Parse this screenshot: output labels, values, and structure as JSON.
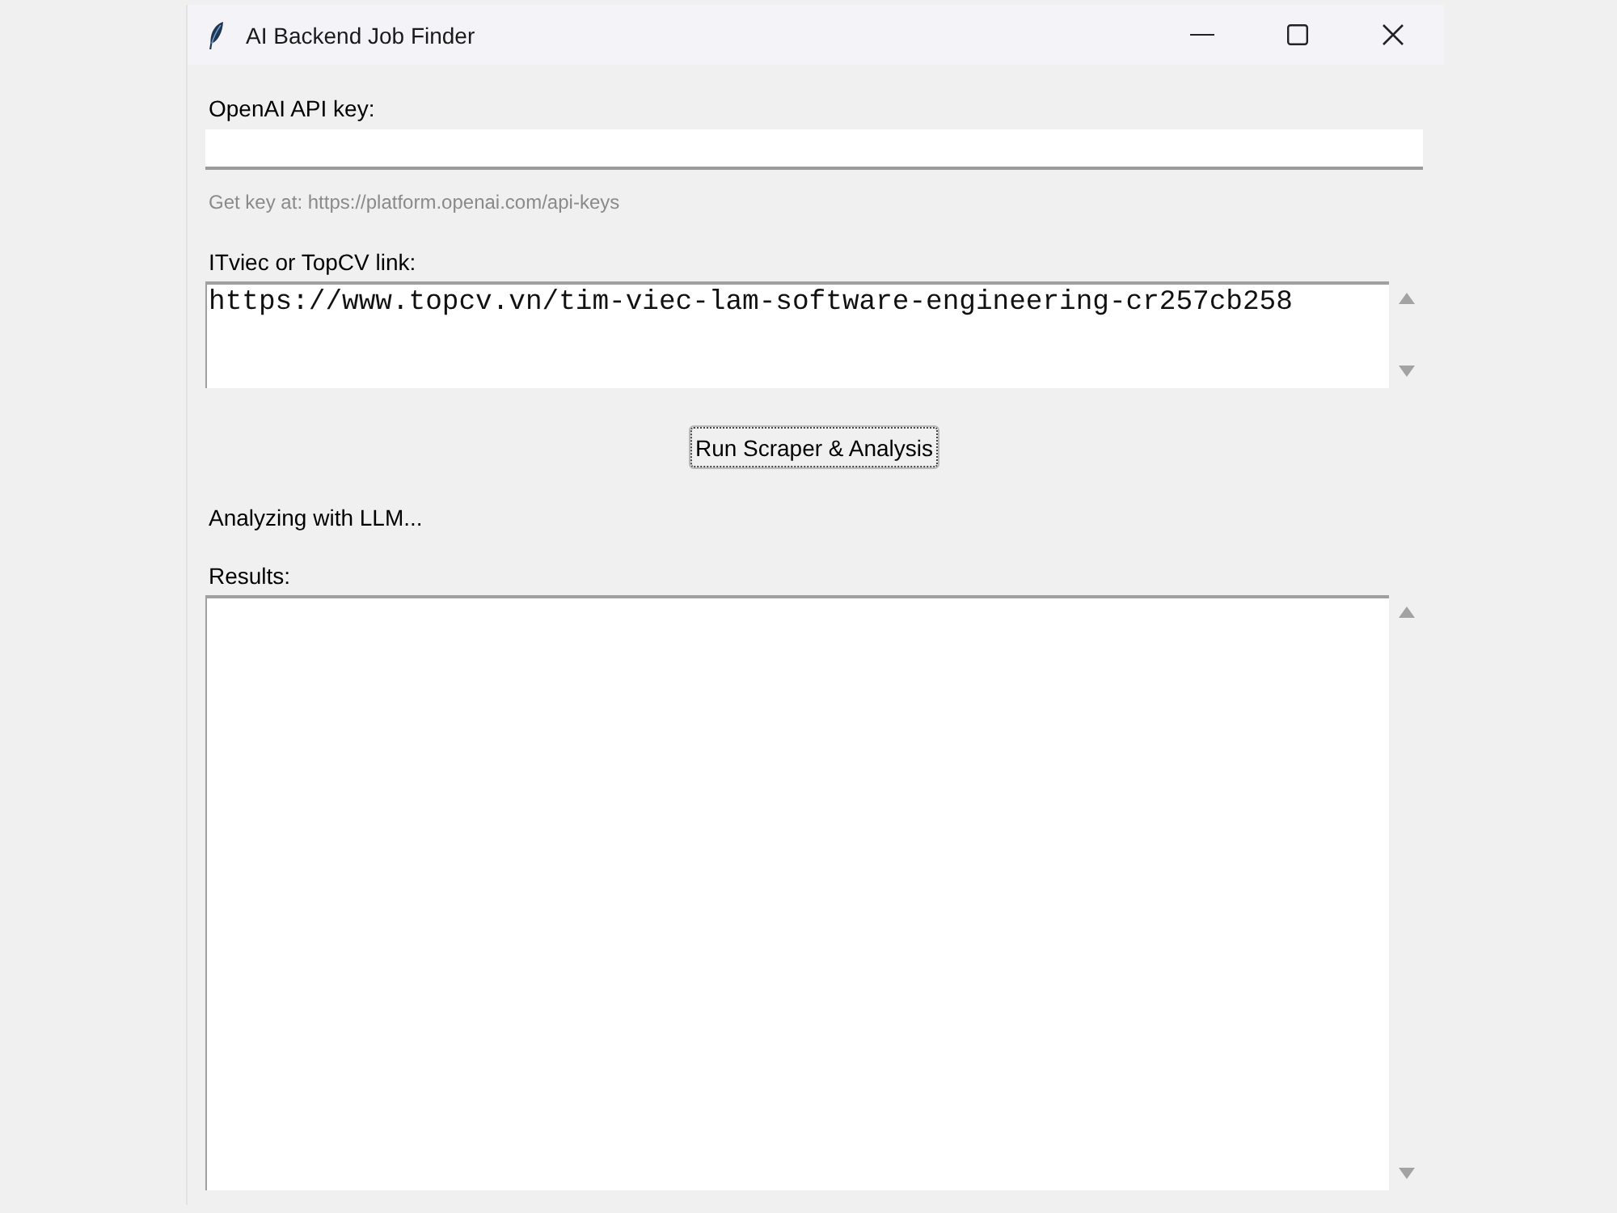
{
  "window": {
    "title": "AI Backend Job Finder"
  },
  "api_key": {
    "label": "OpenAI API key:",
    "hint": "Get key at: https://platform.openai.com/api-keys"
  },
  "link": {
    "label": "ITviec or TopCV link:",
    "value": "https://www.topcv.vn/tim-viec-lam-software-engineering-cr257cb258"
  },
  "run_button": {
    "label": "Run Scraper & Analysis",
    "focused": true
  },
  "status": "Analyzing with LLM...",
  "results": {
    "label": "Results:"
  }
}
